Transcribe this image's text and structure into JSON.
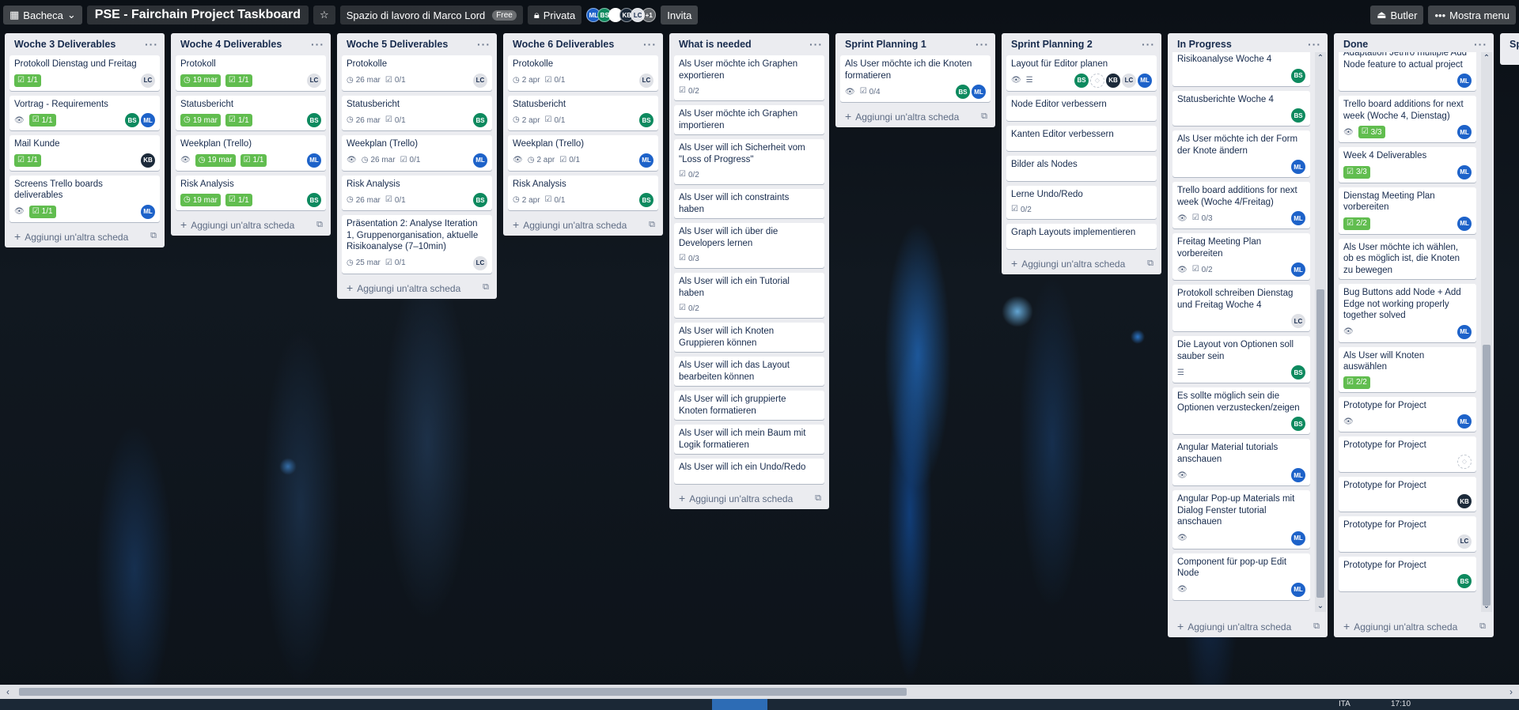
{
  "topbar": {
    "board_menu": "Bacheca",
    "board_title": "PSE - Fairchain Project Taskboard",
    "workspace": "Spazio di lavoro di Marco Lord",
    "workspace_badge": "Free",
    "visibility": "Privata",
    "members": [
      "ML",
      "BS",
      "",
      "KB",
      "LC"
    ],
    "more_members": "+1",
    "invite": "Invita",
    "butler": "Butler",
    "show_menu": "Mostra menu"
  },
  "add_card_label": "Aggiungi un'altra scheda",
  "lists": [
    {
      "title": "Woche 3 Deliverables",
      "cards": [
        {
          "title": "Protokoll Dienstag und Freitag",
          "check": "1/1",
          "members": [
            "LC"
          ]
        },
        {
          "title": "Vortrag - Requirements",
          "watch": true,
          "check": "1/1",
          "members": [
            "BS",
            "ML"
          ]
        },
        {
          "title": "Mail Kunde",
          "check": "1/1",
          "members": [
            "KB"
          ]
        },
        {
          "title": "Screens Trello boards deliverables",
          "watch": true,
          "check": "1/1",
          "members": [
            "ML"
          ]
        }
      ]
    },
    {
      "title": "Woche 4 Deliverables",
      "cards": [
        {
          "title": "Protokoll",
          "date": "19 mar",
          "check": "1/1",
          "members": [
            "LC"
          ]
        },
        {
          "title": "Statusbericht",
          "date": "19 mar",
          "check": "1/1",
          "members": [
            "BS"
          ]
        },
        {
          "title": "Weekplan (Trello)",
          "watch": true,
          "date": "19 mar",
          "check": "1/1",
          "members": [
            "ML"
          ]
        },
        {
          "title": "Risk Analysis",
          "date": "19 mar",
          "check": "1/1",
          "members": [
            "BS"
          ]
        }
      ]
    },
    {
      "title": "Woche 5 Deliverables",
      "cards": [
        {
          "title": "Protokolle",
          "date_plain": "26 mar",
          "check_plain": "0/1",
          "members": [
            "LC"
          ]
        },
        {
          "title": "Statusbericht",
          "date_plain": "26 mar",
          "check_plain": "0/1",
          "members": [
            "BS"
          ]
        },
        {
          "title": "Weekplan (Trello)",
          "watch": true,
          "date_plain": "26 mar",
          "check_plain": "0/1",
          "members": [
            "ML"
          ]
        },
        {
          "title": "Risk Analysis",
          "date_plain": "26 mar",
          "check_plain": "0/1",
          "members": [
            "BS"
          ]
        },
        {
          "title": "Präsentation 2: Analyse Iteration 1, Gruppenorganisation, aktuelle Risikoanalyse (7–10min)",
          "date_plain": "25 mar",
          "check_plain": "0/1",
          "members": [
            "LC"
          ]
        }
      ]
    },
    {
      "title": "Woche 6 Deliverables",
      "cards": [
        {
          "title": "Protokolle",
          "date_plain": "2 apr",
          "check_plain": "0/1",
          "members": [
            "LC"
          ]
        },
        {
          "title": "Statusbericht",
          "date_plain": "2 apr",
          "check_plain": "0/1",
          "members": [
            "BS"
          ]
        },
        {
          "title": "Weekplan (Trello)",
          "watch": true,
          "date_plain": "2 apr",
          "check_plain": "0/1",
          "members": [
            "ML"
          ]
        },
        {
          "title": "Risk Analysis",
          "date_plain": "2 apr",
          "check_plain": "0/1",
          "members": [
            "BS"
          ]
        }
      ]
    },
    {
      "title": "What is needed",
      "cards": [
        {
          "title": "Als User möchte ich Graphen exportieren",
          "check_plain": "0/2"
        },
        {
          "title": "Als User möchte ich Graphen importieren"
        },
        {
          "title": "Als User will ich Sicherheit vom \"Loss of Progress\"",
          "check_plain": "0/2"
        },
        {
          "title": "Als User will ich constraints haben"
        },
        {
          "title": "Als User will ich über die Developers lernen",
          "check_plain": "0/3"
        },
        {
          "title": "Als User will ich ein Tutorial haben",
          "check_plain": "0/2"
        },
        {
          "title": "Als User will ich Knoten Gruppieren können"
        },
        {
          "title": "Als User will ich das Layout bearbeiten können"
        },
        {
          "title": "Als User will ich gruppierte Knoten formatieren"
        },
        {
          "title": "Als User will ich mein Baum mit Logik formatieren"
        },
        {
          "title": "Als User will ich ein Undo/Redo"
        }
      ]
    },
    {
      "title": "Sprint Planning 1",
      "cards": [
        {
          "title": "Als User möchte ich die Knoten formatieren",
          "watch": true,
          "check_plain": "0/4",
          "members": [
            "BS",
            "ML"
          ]
        }
      ]
    },
    {
      "title": "Sprint Planning 2",
      "cards": [
        {
          "title": "Layout für Editor planen",
          "watch": true,
          "desc": true,
          "members": [
            "BS",
            "",
            "KB",
            "LC",
            "ML"
          ]
        },
        {
          "title": "Node Editor verbessern"
        },
        {
          "title": "Kanten Editor verbessern"
        },
        {
          "title": "Bilder als Nodes"
        },
        {
          "title": "Lerne Undo/Redo",
          "check_plain": "0/2"
        },
        {
          "title": "Graph Layouts implementieren"
        }
      ]
    },
    {
      "title": "In Progress",
      "cards": [
        {
          "title": "Risikoanalyse Woche 4",
          "members": [
            "BS"
          ]
        },
        {
          "title": "Statusberichte Woche 4",
          "members": [
            "BS"
          ]
        },
        {
          "title": "Als User möchte ich der Form der Knote ändern",
          "members": [
            "ML"
          ]
        },
        {
          "title": "Trello board additions for next week (Woche 4/Freitag)",
          "watch": true,
          "check_plain": "0/3",
          "members": [
            "ML"
          ]
        },
        {
          "title": "Freitag Meeting Plan vorbereiten",
          "watch": true,
          "check_plain": "0/2",
          "members": [
            "ML"
          ]
        },
        {
          "title": "Protokoll schreiben Dienstag und Freitag Woche 4",
          "members": [
            "LC"
          ]
        },
        {
          "title": "Die Layout von Optionen soll sauber sein",
          "desc": true,
          "members": [
            "BS"
          ]
        },
        {
          "title": "Es sollte möglich sein die Optionen verzustecken/zeigen",
          "members": [
            "BS"
          ]
        },
        {
          "title": "Angular Material tutorials anschauen",
          "watch": true,
          "members": [
            "ML"
          ]
        },
        {
          "title": "Angular Pop-up Materials mit Dialog Fenster tutorial anschauen",
          "watch": true,
          "members": [
            "ML"
          ]
        },
        {
          "title": "Component für pop-up Edit Node",
          "watch": true,
          "members": [
            "ML"
          ]
        }
      ]
    },
    {
      "title": "Done",
      "cards": [
        {
          "title": "Adaptation Jethro multiple Add Node feature to actual project",
          "members": [
            "ML"
          ]
        },
        {
          "title": "Trello board additions for next week (Woche 4, Dienstag)",
          "watch": true,
          "check": "3/3",
          "members": [
            "ML"
          ]
        },
        {
          "title": "Week 4 Deliverables",
          "check": "3/3",
          "members": [
            "ML"
          ]
        },
        {
          "title": "Dienstag Meeting Plan vorbereiten",
          "check": "2/2",
          "members": [
            "ML"
          ]
        },
        {
          "title": "Als User möchte ich wählen, ob es möglich ist, die Knoten zu bewegen"
        },
        {
          "title": "Bug Buttons add Node + Add Edge not working properly together solved",
          "watch": true,
          "members": [
            "ML"
          ]
        },
        {
          "title": "Als User will Knoten auswählen",
          "check": "2/2"
        },
        {
          "title": "Prototype for Project",
          "watch": true,
          "members": [
            "ML"
          ]
        },
        {
          "title": "Prototype for Project",
          "members": [
            ""
          ]
        },
        {
          "title": "Prototype for Project",
          "members": [
            "KB"
          ]
        },
        {
          "title": "Prototype for Project",
          "members": [
            "LC"
          ]
        },
        {
          "title": "Prototype for Project",
          "members": [
            "BS"
          ]
        }
      ]
    },
    {
      "title": "Sp",
      "cards": []
    }
  ],
  "taskbar": {
    "lang": "ITA",
    "time": "17:10"
  }
}
